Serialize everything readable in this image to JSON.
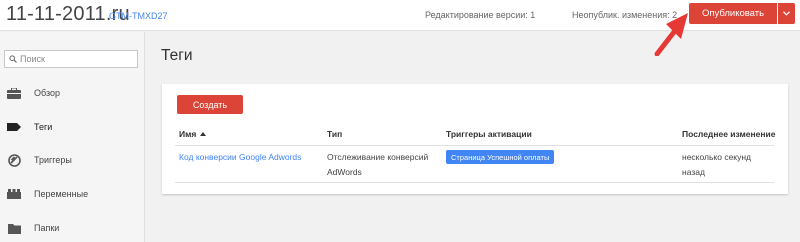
{
  "header": {
    "site_title": "11-11-2011.ru",
    "container_id": "GTM-TMXD27",
    "version_label": "Редактирование версии: 1",
    "changes_label": "Неопублик. изменения: 2",
    "publish_label": "Опубликовать"
  },
  "sidebar": {
    "search_placeholder": "Поиск",
    "items": [
      {
        "label": "Обзор",
        "icon": "briefcase-icon"
      },
      {
        "label": "Теги",
        "icon": "tag-icon"
      },
      {
        "label": "Триггеры",
        "icon": "trigger-icon"
      },
      {
        "label": "Переменные",
        "icon": "blocks-icon"
      },
      {
        "label": "Папки",
        "icon": "folder-icon"
      }
    ],
    "active_item": "Теги"
  },
  "main": {
    "title": "Теги",
    "create_label": "Создать",
    "table": {
      "columns": [
        "Имя",
        "Тип",
        "Триггеры активации",
        "Последнее изменение"
      ],
      "sorted_column": "Имя",
      "rows": [
        {
          "name": "Код конверсии Google Adwords",
          "type_line1": "Отслеживание конверсий",
          "type_line2": "AdWords",
          "trigger": "Страница Успешной оплаты",
          "modified_line1": "несколько секунд",
          "modified_line2": "назад"
        }
      ]
    }
  },
  "colors": {
    "accent_red": "#db4437",
    "link_blue": "#4285f4",
    "annotation_red": "#e53935"
  }
}
